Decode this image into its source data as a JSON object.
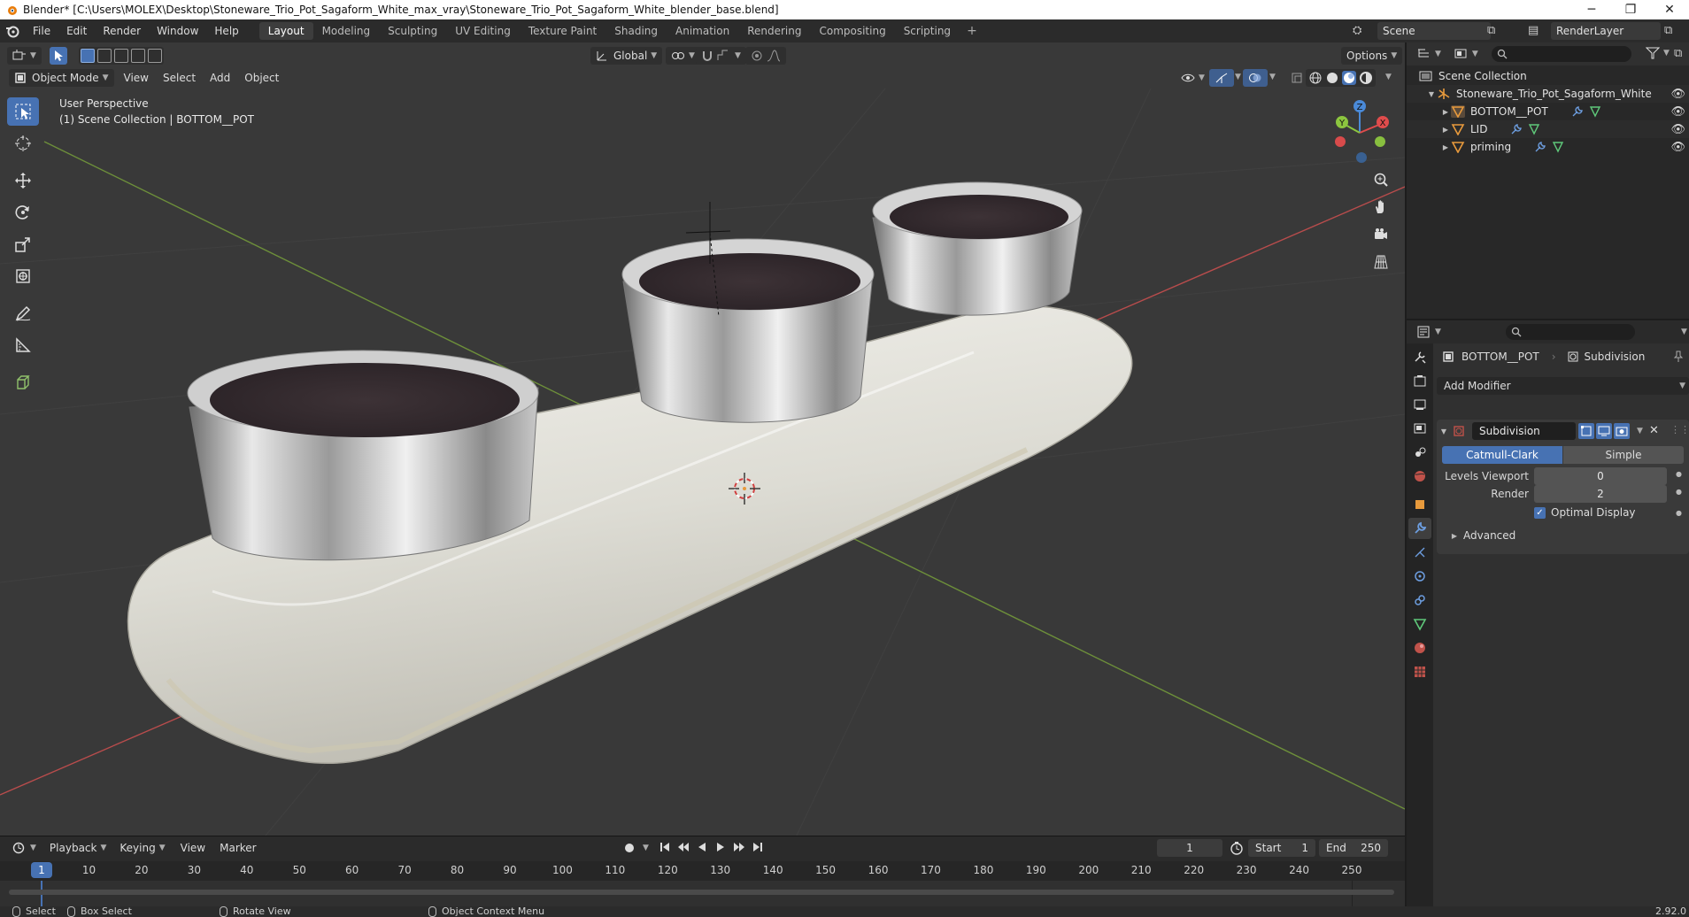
{
  "window": {
    "title": "Blender* [C:\\Users\\MOLEX\\Desktop\\Stoneware_Trio_Pot_Sagaform_White_max_vray\\Stoneware_Trio_Pot_Sagaform_White_blender_base.blend]",
    "minimize": "─",
    "restore": "❐",
    "close": "✕"
  },
  "menubar": {
    "items": [
      "File",
      "Edit",
      "Render",
      "Window",
      "Help"
    ],
    "workspaces": [
      "Layout",
      "Modeling",
      "Sculpting",
      "UV Editing",
      "Texture Paint",
      "Shading",
      "Animation",
      "Rendering",
      "Compositing",
      "Scripting"
    ],
    "active_workspace": "Layout",
    "add_tab": "+",
    "scene": "Scene",
    "view_layer": "RenderLayer"
  },
  "viewport": {
    "mode": "Object Mode",
    "menus": [
      "View",
      "Select",
      "Add",
      "Object"
    ],
    "transform_orientation": "Global",
    "options_label": "Options",
    "info_line1": "User Perspective",
    "info_line2": "(1) Scene Collection | BOTTOM__POT",
    "gizmo": {
      "x": "X",
      "y": "Y",
      "z": "Z"
    }
  },
  "outliner": {
    "root": "Scene Collection",
    "collection": "Stoneware_Trio_Pot_Sagaform_White",
    "objects": [
      "BOTTOM__POT",
      "LID",
      "priming"
    ]
  },
  "properties": {
    "object_name": "BOTTOM__POT",
    "modifier_breadcrumb": "Subdivision",
    "add_modifier": "Add Modifier",
    "modifier": {
      "name": "Subdivision",
      "algorithm_options": [
        "Catmull-Clark",
        "Simple"
      ],
      "active_algorithm": "Catmull-Clark",
      "levels_viewport_label": "Levels Viewport",
      "levels_viewport": "0",
      "render_label": "Render",
      "render": "2",
      "optimal_display_label": "Optimal Display",
      "optimal_display": true,
      "advanced_label": "Advanced"
    }
  },
  "timeline": {
    "menus": [
      "Playback",
      "Keying",
      "View",
      "Marker"
    ],
    "current_frame": "1",
    "start_label": "Start",
    "start": "1",
    "end_label": "End",
    "end": "250",
    "ticks": [
      "1",
      "10",
      "20",
      "30",
      "40",
      "50",
      "60",
      "70",
      "80",
      "90",
      "100",
      "110",
      "120",
      "130",
      "140",
      "150",
      "160",
      "170",
      "180",
      "190",
      "200",
      "210",
      "220",
      "230",
      "240",
      "250"
    ]
  },
  "statusbar": {
    "select": "Select",
    "box_select": "Box Select",
    "rotate_view": "Rotate View",
    "context_menu": "Object Context Menu",
    "version": "2.92.0"
  },
  "colors": {
    "accent": "#4772b3",
    "x_axis": "#e04c4c",
    "y_axis": "#8cc63f",
    "z_axis": "#4a8ad8",
    "object_orange": "#e89a3c"
  }
}
